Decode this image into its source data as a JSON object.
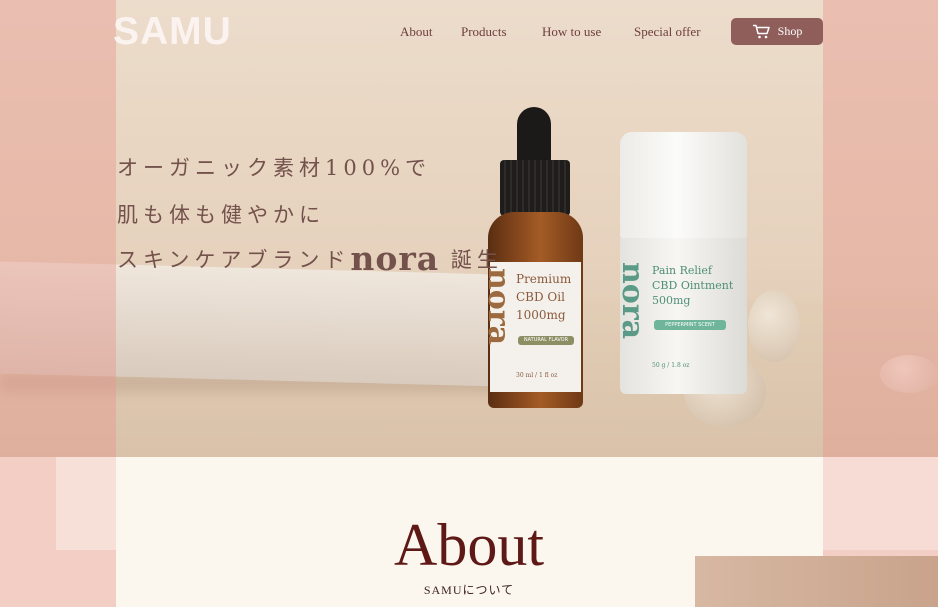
{
  "header": {
    "logo": "SAMU",
    "nav": [
      {
        "label": "About"
      },
      {
        "label": "Products"
      },
      {
        "label": "How to use"
      },
      {
        "label": "Special offer"
      }
    ],
    "shop_label": "Shop",
    "shop_icon": "cart-icon"
  },
  "hero": {
    "line1": "オーガニック素材100%で",
    "line2": "肌も体も健やかに",
    "line3_prefix": "スキンケアブランド",
    "line3_brand": "nora",
    "line3_suffix": "誕生"
  },
  "products": {
    "oil": {
      "brand": "nora",
      "name_line1": "Premium",
      "name_line2": "CBD Oil",
      "name_line3": "1000mg",
      "tag": "NATURAL FLAVOR",
      "volume": "30 ml / 1 fl oz"
    },
    "ointment": {
      "brand": "nora",
      "name_line1": "Pain Relief",
      "name_line2": "CBD Ointment",
      "name_line3": "500mg",
      "tag": "PEPPERMINT SCENT",
      "volume": "50 g / 1.8 oz"
    }
  },
  "about": {
    "title": "About",
    "subtitle": "SAMUについて"
  },
  "colors": {
    "nav_text": "#6f3e3e",
    "shop_button": "#8f5d5a",
    "about_title": "#5e1816",
    "hero_text": "#74524c",
    "overlay_pink": "#e8a79c"
  }
}
